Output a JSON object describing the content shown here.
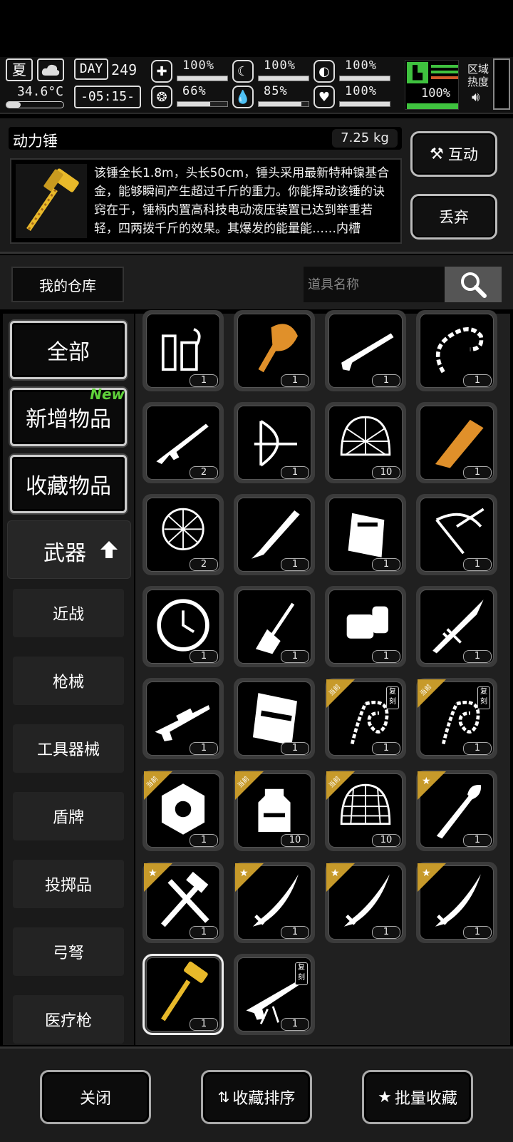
{
  "hud": {
    "season": "夏",
    "temperature": "34.6°C",
    "day_label": "DAY",
    "day": "249",
    "time": "-05:15-",
    "stats": [
      {
        "name": "health",
        "icon": "first-aid-icon",
        "value": "100%",
        "fill": 1.0
      },
      {
        "name": "stamina",
        "icon": "sleep-moon-icon",
        "value": "100%",
        "fill": 1.0
      },
      {
        "name": "armor",
        "icon": "helmet-icon",
        "value": "100%",
        "fill": 1.0
      },
      {
        "name": "hunger",
        "icon": "stomach-icon",
        "value": "66%",
        "fill": 0.66
      },
      {
        "name": "thirst",
        "icon": "water-drop-icon",
        "value": "85%",
        "fill": 0.85
      },
      {
        "name": "mood",
        "icon": "heart-icon",
        "value": "100%",
        "fill": 1.0
      },
      {
        "name": "boots",
        "icon": "boot-icon",
        "value": "100%",
        "fill": 1.0
      }
    ],
    "region_label": "区域\n热度"
  },
  "item": {
    "name": "动力锤",
    "weight": "7.25 kg",
    "description": "该锤全长1.8m，头长50cm，锤头采用最新特种镍基合金，能够瞬间产生超过千斤的重力。你能挥动该锤的诀窍在于，锤柄内置高科技电动液压装置已达到举重若轻，四两拨千斤的效果。其爆发的能量能……内槽即……度无穷",
    "interact_label": "互动",
    "discard_label": "丢弃"
  },
  "storage": {
    "title": "我的仓库",
    "search_placeholder": "道具名称"
  },
  "sidebar": {
    "main": [
      "全部",
      "新增物品",
      "收藏物品"
    ],
    "new_badge": "New",
    "category": "武器",
    "subs": [
      "近战",
      "枪械",
      "工具器械",
      "盾牌",
      "投掷品",
      "弓弩",
      "医疗枪"
    ]
  },
  "tags": {
    "current": "当前",
    "replica": "复刻"
  },
  "items": [
    {
      "icon": "potion-flasks-icon",
      "count": "1"
    },
    {
      "icon": "flaming-horse-club-icon",
      "count": "1",
      "color": "#e0902a"
    },
    {
      "icon": "shotgun-icon",
      "count": "1"
    },
    {
      "icon": "thorn-whip-icon",
      "count": "1"
    },
    {
      "icon": "assault-rifle-icon",
      "count": "2"
    },
    {
      "icon": "compound-bow-icon",
      "count": "1"
    },
    {
      "icon": "spiked-net-icon",
      "count": "10"
    },
    {
      "icon": "golden-cannon-icon",
      "count": "1",
      "color": "#e0902a"
    },
    {
      "icon": "tangled-net-icon",
      "count": "2"
    },
    {
      "icon": "machete-icon",
      "count": "1"
    },
    {
      "icon": "ballistic-shield-block-icon",
      "count": "1"
    },
    {
      "icon": "crossbow-icon",
      "count": "1"
    },
    {
      "icon": "clock-shield-icon",
      "count": "1"
    },
    {
      "icon": "horse-guitar-icon",
      "count": "1"
    },
    {
      "icon": "power-gauntlet-icon",
      "count": "1"
    },
    {
      "icon": "spear-icon",
      "count": "1"
    },
    {
      "icon": "sniper-rifle-icon",
      "count": "1"
    },
    {
      "icon": "riot-shield-icon",
      "count": "1"
    },
    {
      "icon": "chain-whip-icon",
      "count": "1",
      "tag": "current",
      "replica": true
    },
    {
      "icon": "chain-whip-icon",
      "count": "1",
      "tag": "current",
      "replica": true
    },
    {
      "icon": "hexagon-shield-icon",
      "count": "1",
      "tag": "current"
    },
    {
      "icon": "flask-bottle-icon",
      "count": "10",
      "tag": "current"
    },
    {
      "icon": "dome-net-icon",
      "count": "10",
      "tag": "current"
    },
    {
      "icon": "shovel-icon",
      "count": "1",
      "tag": "star"
    },
    {
      "icon": "hammer-wrench-icon",
      "count": "1",
      "tag": "star"
    },
    {
      "icon": "katana-icon",
      "count": "1",
      "tag": "star"
    },
    {
      "icon": "katana-icon",
      "count": "1",
      "tag": "star"
    },
    {
      "icon": "katana-icon",
      "count": "1",
      "tag": "star"
    },
    {
      "icon": "power-hammer-icon",
      "count": "1",
      "color": "#e8b92a",
      "selected": true
    },
    {
      "icon": "heavy-sniper-icon",
      "count": "1",
      "replica": true
    }
  ],
  "bottom": {
    "close": "关闭",
    "sort": "收藏排序",
    "batch": "批量收藏"
  }
}
